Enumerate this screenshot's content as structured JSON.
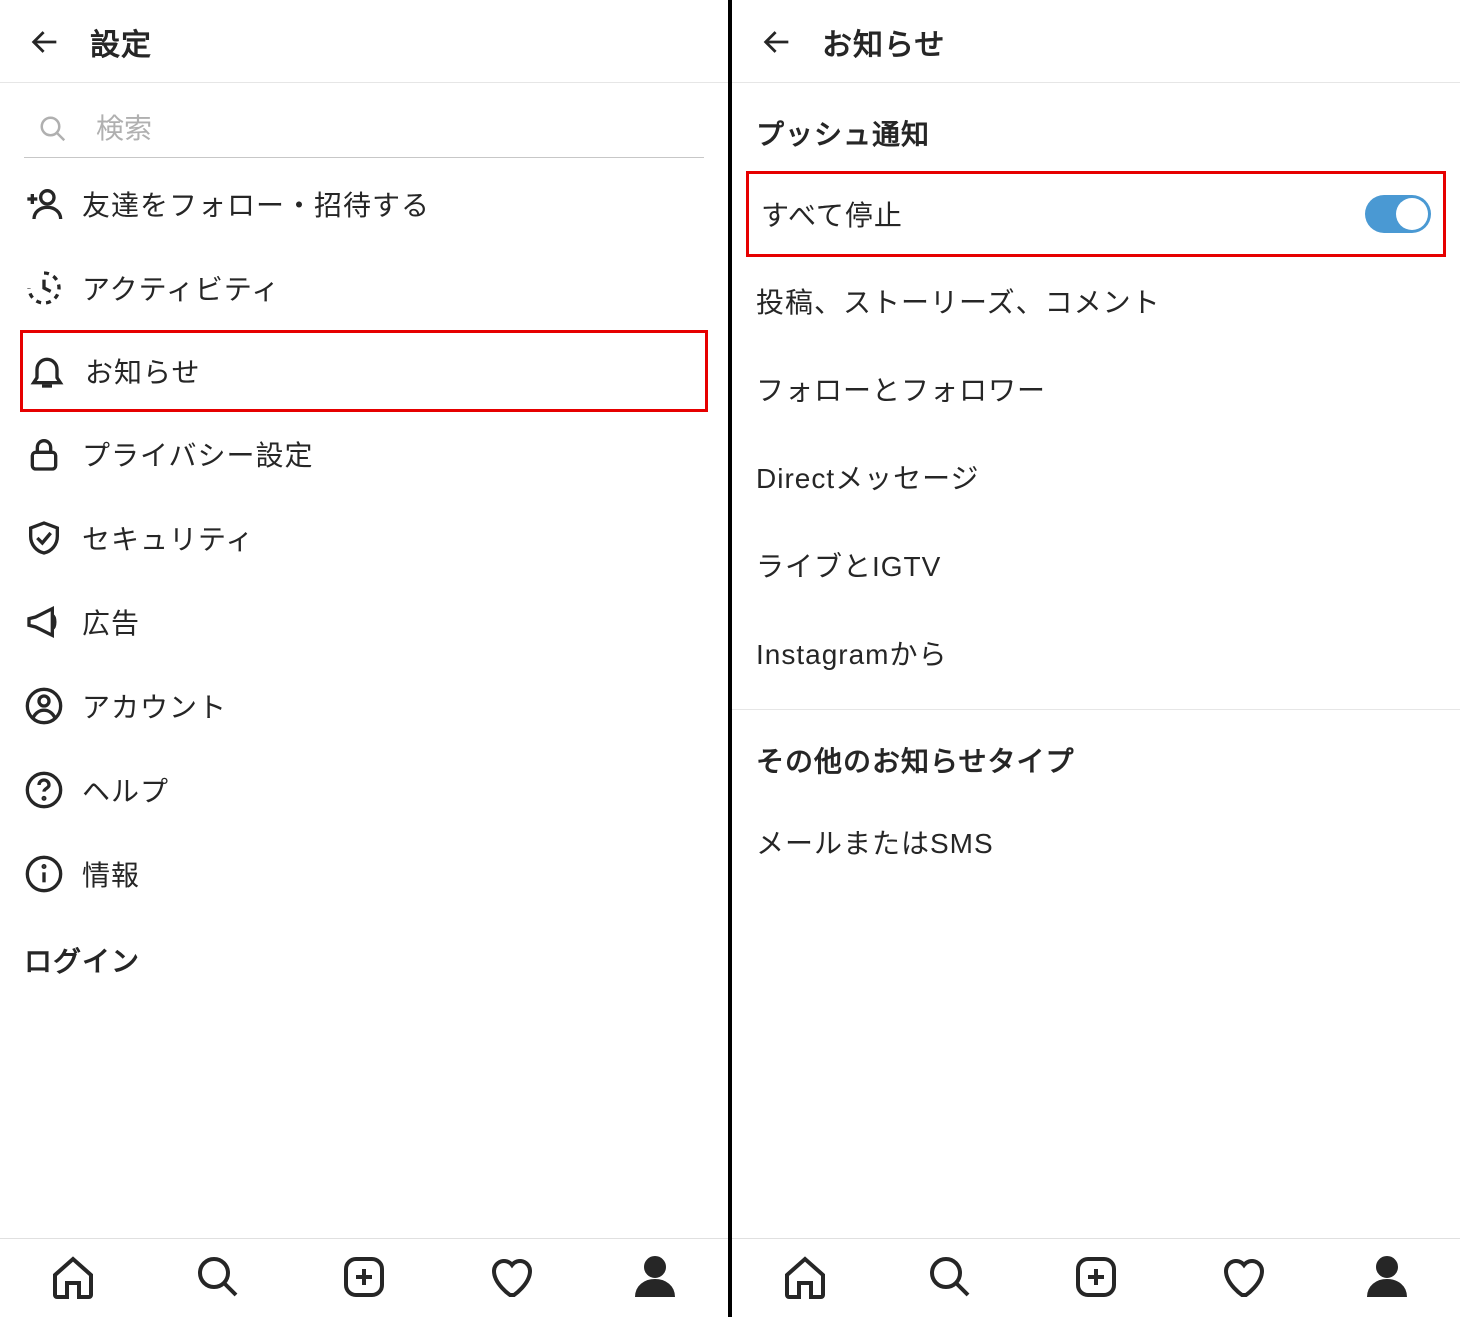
{
  "left": {
    "header_title": "設定",
    "search_placeholder": "検索",
    "menu": {
      "follow_invite": "友達をフォロー・招待する",
      "activity": "アクティビティ",
      "notifications": "お知らせ",
      "privacy": "プライバシー設定",
      "security": "セキュリティ",
      "ads": "広告",
      "account": "アカウント",
      "help": "ヘルプ",
      "info": "情報"
    },
    "section_login": "ログイン"
  },
  "right": {
    "header_title": "お知らせ",
    "section_push": "プッシュ通知",
    "pause_all_label": "すべて停止",
    "pause_all_on": true,
    "items": {
      "posts_stories_comments": "投稿、ストーリーズ、コメント",
      "following_followers": "フォローとフォロワー",
      "direct_messages": "Directメッセージ",
      "live_igtv": "ライブとIGTV",
      "from_instagram": "Instagramから"
    },
    "section_other": "その他のお知らせタイプ",
    "email_sms": "メールまたはSMS"
  }
}
